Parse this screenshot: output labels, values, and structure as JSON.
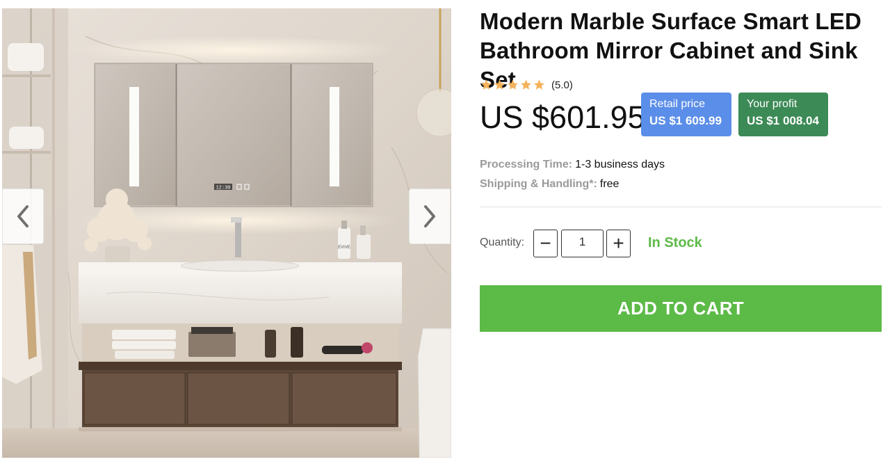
{
  "product": {
    "title": "Modern Marble Surface Smart LED Bathroom Mirror Cabinet and Sink Set",
    "rating": {
      "stars": 5,
      "text": "(5.0)"
    },
    "price": "US $601.95",
    "retail": {
      "label": "Retail price",
      "value": "US $1 609.99"
    },
    "profit": {
      "label": "Your profit",
      "value": "US $1 008.04"
    }
  },
  "details": {
    "processing_label": "Processing Time:",
    "processing_value": "1-3 business days",
    "shipping_label": "Shipping & Handling*:",
    "shipping_value": "free"
  },
  "quantity": {
    "label": "Quantity:",
    "value": "1",
    "minus_symbol": "−",
    "plus_symbol": "+"
  },
  "stock_status": "In Stock",
  "cart": {
    "label": "ADD TO CART"
  },
  "gallery": {
    "prev_icon": "chevron-left-icon",
    "next_icon": "chevron-right-icon",
    "mirror_clock": "12:30",
    "bottle_label": "EVIVE"
  },
  "colors": {
    "accent_green": "#5cba47",
    "retail_blue": "#5b8ee8",
    "profit_green": "#3c8a56",
    "star_gold": "#f3b35a"
  }
}
